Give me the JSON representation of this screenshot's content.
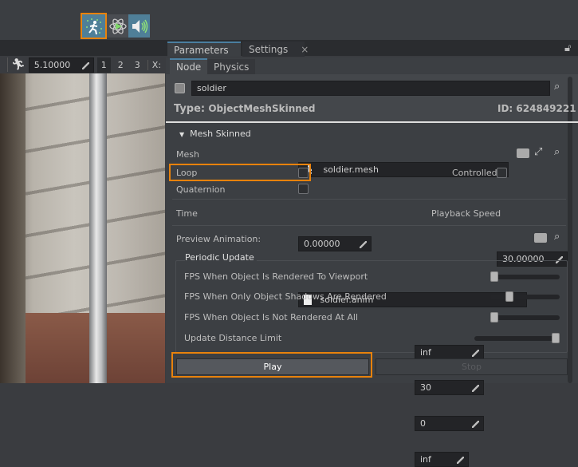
{
  "toolbar": {
    "icons": [
      "particles-icon",
      "physics-play-icon",
      "sound-icon"
    ],
    "active": "particles-icon"
  },
  "viewport_toolbar": {
    "speed": "5.10000",
    "nums": [
      "1",
      "2",
      "3"
    ],
    "axis_label": "X:"
  },
  "tabs": [
    {
      "label": "Parameters",
      "close": "×",
      "active": true
    },
    {
      "label": "Settings",
      "close": "×",
      "active": false
    }
  ],
  "subtabs": [
    {
      "label": "Node",
      "active": true
    },
    {
      "label": "Physics",
      "active": false
    }
  ],
  "node": {
    "name": "soldier",
    "type_label": "Type:",
    "type": "ObjectMeshSkinned",
    "id_label": "ID:",
    "id": "624849221"
  },
  "mesh_skinned": {
    "header": "Mesh Skinned",
    "mesh_label": "Mesh",
    "mesh": "soldier.mesh",
    "loop_label": "Loop",
    "loop": false,
    "controlled_label": "Controlled",
    "controlled": false,
    "quaternion_label": "Quaternion",
    "quaternion": false,
    "time_label": "Time",
    "time": "0.00000",
    "speed_label": "Playback Speed",
    "speed": "30.00000",
    "preview_label": "Preview Animation:",
    "preview": "soldier.anim"
  },
  "periodic": {
    "title": "Periodic Update",
    "rows": [
      {
        "label": "FPS When Object Is Rendered To Viewport",
        "value": "inf",
        "slider": 0
      },
      {
        "label": "FPS When Only Object Shadows Are Rendered",
        "value": "30",
        "slider": 0.25
      },
      {
        "label": "FPS When Object Is Not Rendered At All",
        "value": "0",
        "slider": 0
      },
      {
        "label": "Update Distance Limit",
        "value": "inf",
        "slider": 1
      }
    ]
  },
  "buttons": {
    "play": "Play",
    "stop": "Stop"
  },
  "colors": {
    "highlight": "#e8820c",
    "accent": "#4a7ea0"
  }
}
